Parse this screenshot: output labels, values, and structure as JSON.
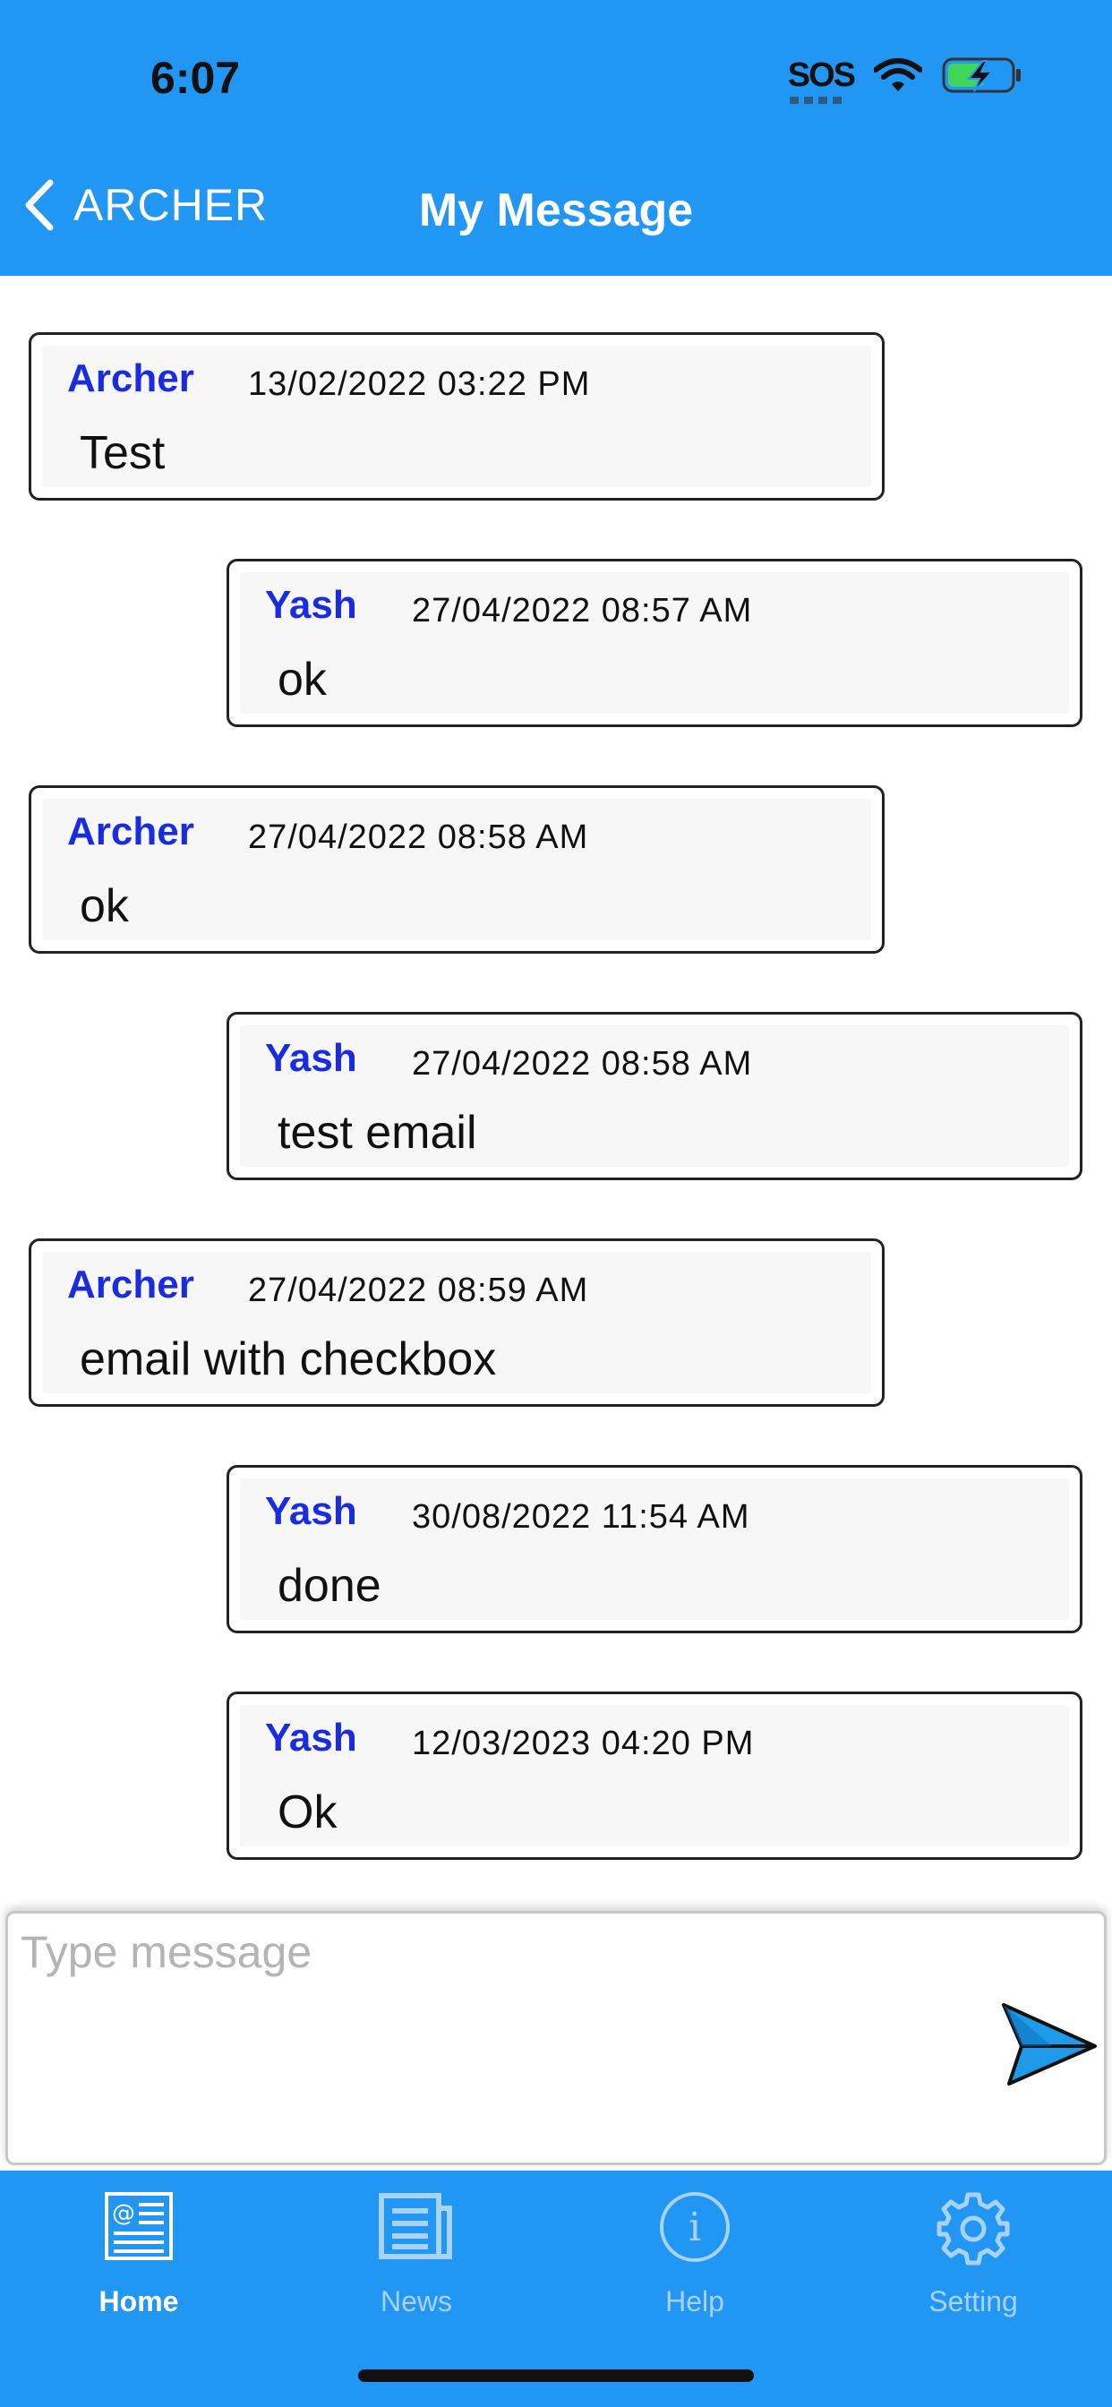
{
  "status_bar": {
    "time": "6:07",
    "sos": "SOS"
  },
  "header": {
    "back_label": "ARCHER",
    "title": "My Message"
  },
  "messages": [
    {
      "side": "left",
      "sender": "Archer",
      "timestamp": "13/02/2022 03:22 PM",
      "text": "Test"
    },
    {
      "side": "right",
      "sender": "Yash",
      "timestamp": "27/04/2022 08:57 AM",
      "text": "ok"
    },
    {
      "side": "left",
      "sender": "Archer",
      "timestamp": "27/04/2022 08:58 AM",
      "text": "ok"
    },
    {
      "side": "right",
      "sender": "Yash",
      "timestamp": "27/04/2022 08:58 AM",
      "text": "test email"
    },
    {
      "side": "left",
      "sender": "Archer",
      "timestamp": "27/04/2022 08:59 AM",
      "text": "email with checkbox"
    },
    {
      "side": "right",
      "sender": "Yash",
      "timestamp": "30/08/2022 11:54 AM",
      "text": "done"
    },
    {
      "side": "right",
      "sender": "Yash",
      "timestamp": "12/03/2023 04:20 PM",
      "text": "Ok"
    }
  ],
  "composer": {
    "placeholder": "Type message",
    "value": ""
  },
  "tabs": [
    {
      "label": "Home",
      "icon": "home-newspaper-icon",
      "active": true
    },
    {
      "label": "News",
      "icon": "news-icon",
      "active": false
    },
    {
      "label": "Help",
      "icon": "info-icon",
      "active": false
    },
    {
      "label": "Setting",
      "icon": "gear-icon",
      "active": false
    }
  ],
  "colors": {
    "header_bg": "#2196f3",
    "sender_name": "#1a2ce0",
    "send_icon": "#1e9be8",
    "tab_inactive": "#a9d2f7"
  }
}
